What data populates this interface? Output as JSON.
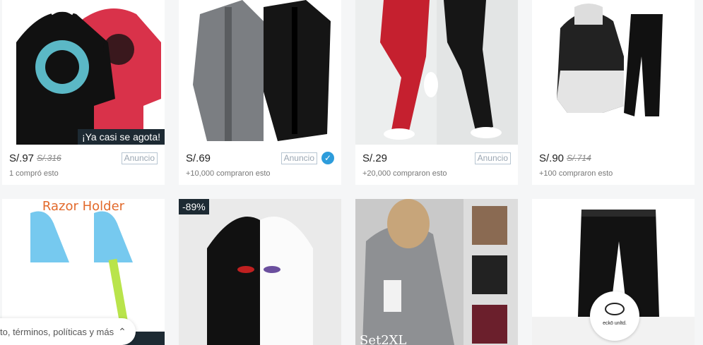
{
  "row1": [
    {
      "price": "S/.97",
      "old_price": "S/.316",
      "badge": "Anuncio",
      "sold": "1 compró esto",
      "tag": "¡Ya casi se agota!"
    },
    {
      "price": "S/.69",
      "old_price": "",
      "badge": "Anuncio",
      "verified": true,
      "sold": "+10,000 compraron esto"
    },
    {
      "price": "S/.29",
      "old_price": "",
      "badge": "Anuncio",
      "sold": "+20,000 compraron esto"
    },
    {
      "price": "S/.90",
      "old_price": "S/.714",
      "badge": "",
      "sold": "+100 compraron esto"
    }
  ],
  "row2": [
    {
      "title": "Razor Holder"
    },
    {
      "discount": "-89%"
    },
    {
      "overlay_text": "Set2XL"
    },
    {
      "brand": "eckō unltd."
    }
  ],
  "footer": {
    "label": "to, términos, políticas y más"
  },
  "icons": {
    "verified": "check-badge-icon",
    "expand": "chevron-up-icon"
  },
  "colors": {
    "tag_bg": "#1d2a33",
    "verified": "#2d9cdb",
    "razor_title": "#e26a2c"
  }
}
